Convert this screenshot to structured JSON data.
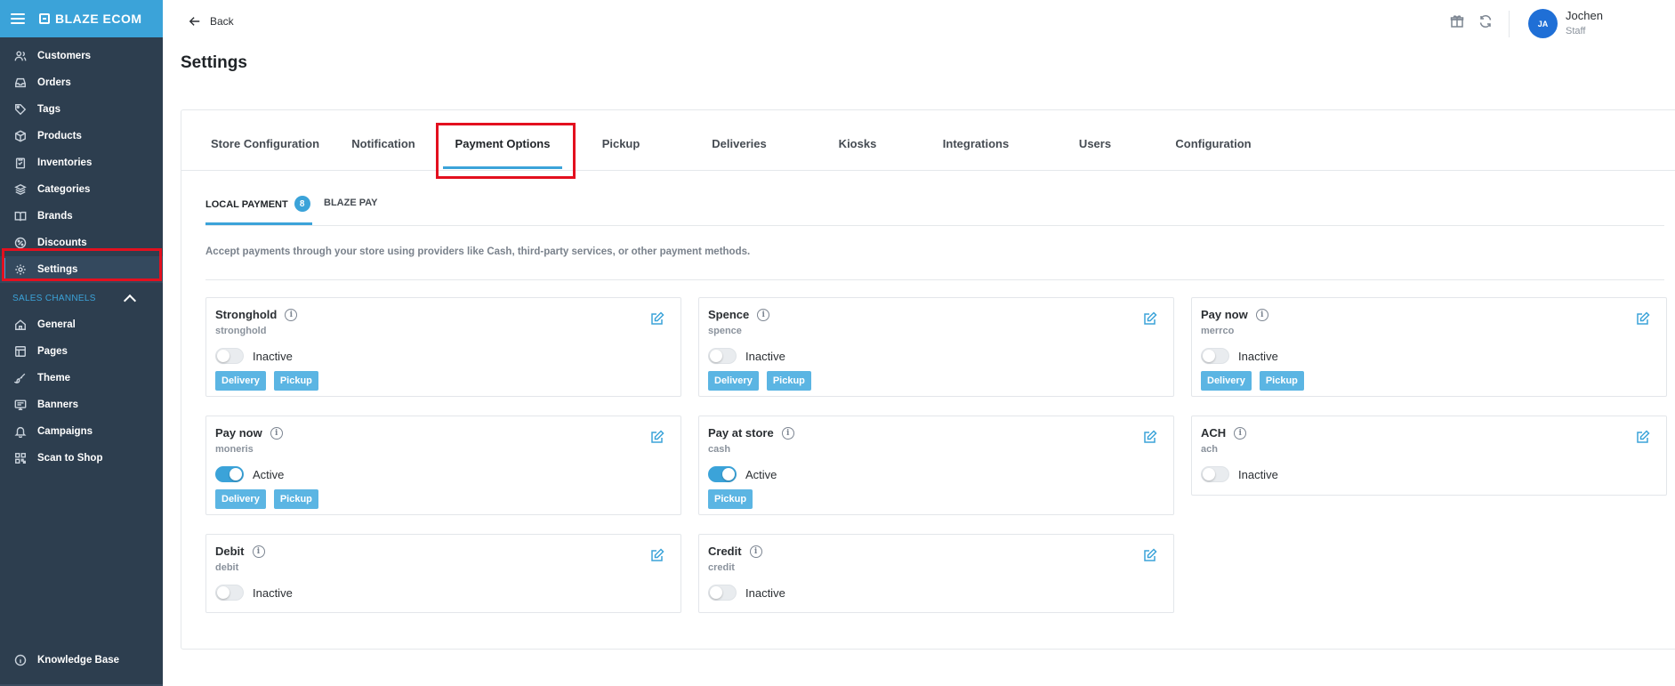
{
  "brand": {
    "name": "BLAZE ECOM"
  },
  "sidebar": {
    "items": [
      {
        "label": "Customers",
        "icon": "users-icon"
      },
      {
        "label": "Orders",
        "icon": "inbox-icon"
      },
      {
        "label": "Tags",
        "icon": "tag-icon"
      },
      {
        "label": "Products",
        "icon": "box-icon"
      },
      {
        "label": "Inventories",
        "icon": "clipboard-icon"
      },
      {
        "label": "Categories",
        "icon": "layers-icon"
      },
      {
        "label": "Brands",
        "icon": "book-icon"
      },
      {
        "label": "Discounts",
        "icon": "discount-icon"
      },
      {
        "label": "Settings",
        "icon": "gear-icon"
      }
    ],
    "channels_label": "SALES CHANNELS",
    "channel_items": [
      {
        "label": "General",
        "icon": "home-icon"
      },
      {
        "label": "Pages",
        "icon": "layout-icon"
      },
      {
        "label": "Theme",
        "icon": "brush-icon"
      },
      {
        "label": "Banners",
        "icon": "monitor-icon"
      },
      {
        "label": "Campaigns",
        "icon": "bell-icon"
      },
      {
        "label": "Scan to Shop",
        "icon": "qr-icon"
      }
    ],
    "knowledge_base": "Knowledge Base"
  },
  "header": {
    "back_label": "Back",
    "title": "Settings",
    "user": {
      "initials": "JA",
      "name": "Jochen",
      "role": "Staff"
    }
  },
  "tabs": [
    "Store Configuration",
    "Notification",
    "Payment Options",
    "Pickup",
    "Deliveries",
    "Kiosks",
    "Integrations",
    "Users",
    "Configuration"
  ],
  "active_tab": "Payment Options",
  "subtabs": {
    "local": "LOCAL PAYMENT",
    "local_count": "8",
    "blaze": "BLAZE PAY"
  },
  "description": "Accept payments through your store using providers like Cash, third-party services, or other payment methods.",
  "payments": [
    {
      "name": "Stronghold",
      "code": "stronghold",
      "status": "Inactive",
      "active": false,
      "tags": [
        "Delivery",
        "Pickup"
      ]
    },
    {
      "name": "Spence",
      "code": "spence",
      "status": "Inactive",
      "active": false,
      "tags": [
        "Delivery",
        "Pickup"
      ]
    },
    {
      "name": "Pay now",
      "code": "merrco",
      "status": "Inactive",
      "active": false,
      "tags": [
        "Delivery",
        "Pickup"
      ]
    },
    {
      "name": "Pay now",
      "code": "moneris",
      "status": "Active",
      "active": true,
      "tags": [
        "Delivery",
        "Pickup"
      ]
    },
    {
      "name": "Pay at store",
      "code": "cash",
      "status": "Active",
      "active": true,
      "tags": [
        "Pickup"
      ]
    },
    {
      "name": "ACH",
      "code": "ach",
      "status": "Inactive",
      "active": false,
      "tags": []
    },
    {
      "name": "Debit",
      "code": "debit",
      "status": "Inactive",
      "active": false,
      "tags": []
    },
    {
      "name": "Credit",
      "code": "credit",
      "status": "Inactive",
      "active": false,
      "tags": []
    }
  ],
  "colors": {
    "accent": "#3ba3d9",
    "sidebar": "#2d3e4f",
    "highlight": "#e3101f"
  }
}
